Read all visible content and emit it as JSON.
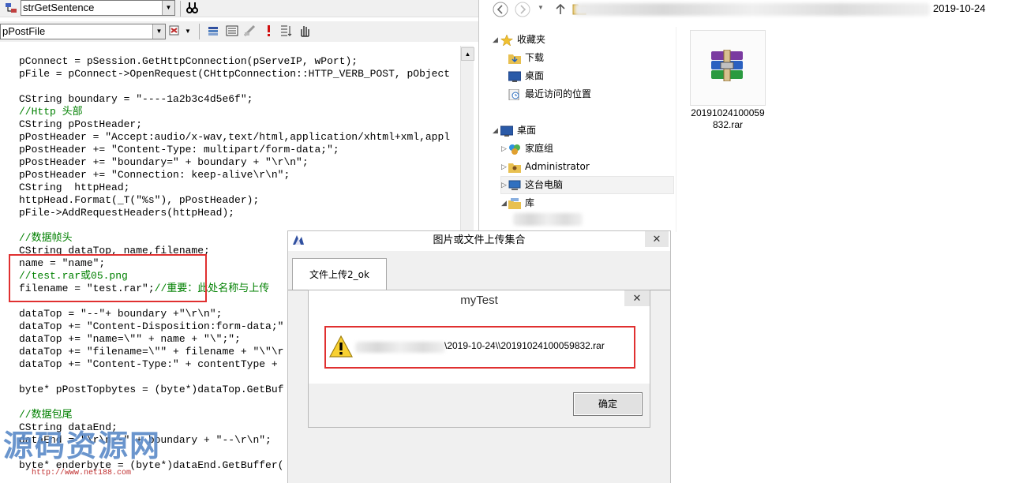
{
  "ide": {
    "function_combo": "strGetSentence",
    "member_combo": "pPostFile",
    "code_lines": [
      {
        "text": "pConnect = pSession.GetHttpConnection(pServeIP, wPort);",
        "comment": false
      },
      {
        "text": "pFile = pConnect->OpenRequest(CHttpConnection::HTTP_VERB_POST, pObject",
        "comment": false
      },
      {
        "text": "",
        "comment": false
      },
      {
        "text": "CString boundary = \"----1a2b3c4d5e6f\";",
        "comment": false
      },
      {
        "text": "//Http 头部",
        "comment": true
      },
      {
        "text": "CString pPostHeader;",
        "comment": false
      },
      {
        "text": "pPostHeader = \"Accept:audio/x-wav,text/html,application/xhtml+xml,appl",
        "comment": false
      },
      {
        "text": "pPostHeader += \"Content-Type: multipart/form-data;\";",
        "comment": false
      },
      {
        "text": "pPostHeader += \"boundary=\" + boundary + \"\\r\\n\";",
        "comment": false
      },
      {
        "text": "pPostHeader += \"Connection: keep-alive\\r\\n\";",
        "comment": false
      },
      {
        "text": "CString  httpHead;",
        "comment": false
      },
      {
        "text": "httpHead.Format(_T(\"%s\"), pPostHeader);",
        "comment": false
      },
      {
        "text": "pFile->AddRequestHeaders(httpHead);",
        "comment": false
      },
      {
        "text": "",
        "comment": false
      },
      {
        "text": "//数据帧头",
        "comment": true
      },
      {
        "text": "CString dataTop, name,filename;",
        "comment": false
      },
      {
        "text": "name = \"name\";",
        "comment": false
      },
      {
        "text": "//test.rar或05.png",
        "comment": true
      },
      {
        "text": "filename = \"test.rar\";",
        "comment": false,
        "trailing_comment": "//重要：此处名称与上传"
      },
      {
        "text": "",
        "comment": false
      },
      {
        "text": "dataTop = \"--\"+ boundary +\"\\r\\n\";",
        "comment": false
      },
      {
        "text": "dataTop += \"Content-Disposition:form-data;\"",
        "comment": false
      },
      {
        "text": "dataTop += \"name=\\\"\" + name + \"\\\";\";",
        "comment": false
      },
      {
        "text": "dataTop += \"filename=\\\"\" + filename + \"\\\"\\r",
        "comment": false
      },
      {
        "text": "dataTop += \"Content-Type:\" + contentType +",
        "comment": false
      },
      {
        "text": "",
        "comment": false
      },
      {
        "text": "byte* pPostTopbytes = (byte*)dataTop.GetBuf",
        "comment": false
      },
      {
        "text": "",
        "comment": false
      },
      {
        "text": "//数据包尾",
        "comment": true
      },
      {
        "text": "CString dataEnd;",
        "comment": false
      },
      {
        "text": "dataEnd = \"\\r\\n--\" + boundary + \"--\\r\\n\";",
        "comment": false
      },
      {
        "text": "",
        "comment": false
      },
      {
        "text": "byte* enderbyte = (byte*)dataEnd.GetBuffer(",
        "comment": false
      }
    ],
    "watermark": "源码资源网",
    "watermark_url": "http://www.net188.com"
  },
  "explorer": {
    "breadcrumb_date": "2019-10-24",
    "nav_items": [
      {
        "label": "收藏夹",
        "icon": "star-icon"
      },
      {
        "label": "下载",
        "icon": "download-folder-icon"
      },
      {
        "label": "桌面",
        "icon": "desktop-icon"
      },
      {
        "label": "最近访问的位置",
        "icon": "recent-places-icon"
      },
      {
        "label": "桌面",
        "icon": "desktop-icon"
      },
      {
        "label": "家庭组",
        "icon": "homegroup-icon"
      },
      {
        "label": "Administrator",
        "icon": "user-folder-icon"
      },
      {
        "label": "这台电脑",
        "icon": "computer-icon"
      },
      {
        "label": "库",
        "icon": "library-icon"
      }
    ],
    "file": {
      "name": "20191024100059832.rar",
      "icon": "winrar-archive-icon"
    }
  },
  "dialog": {
    "title": "图片或文件上传集合",
    "close": "✕",
    "tab_label": "文件上传2_ok"
  },
  "message_box": {
    "title": "myTest",
    "close": "✕",
    "message": "\\2019-10-24\\\\20191024100059832.rar",
    "ok_button": "确定"
  },
  "colors": {
    "highlight_red": "#e03030",
    "comment_green": "#008000",
    "watermark_blue": "#5a8ac8"
  }
}
